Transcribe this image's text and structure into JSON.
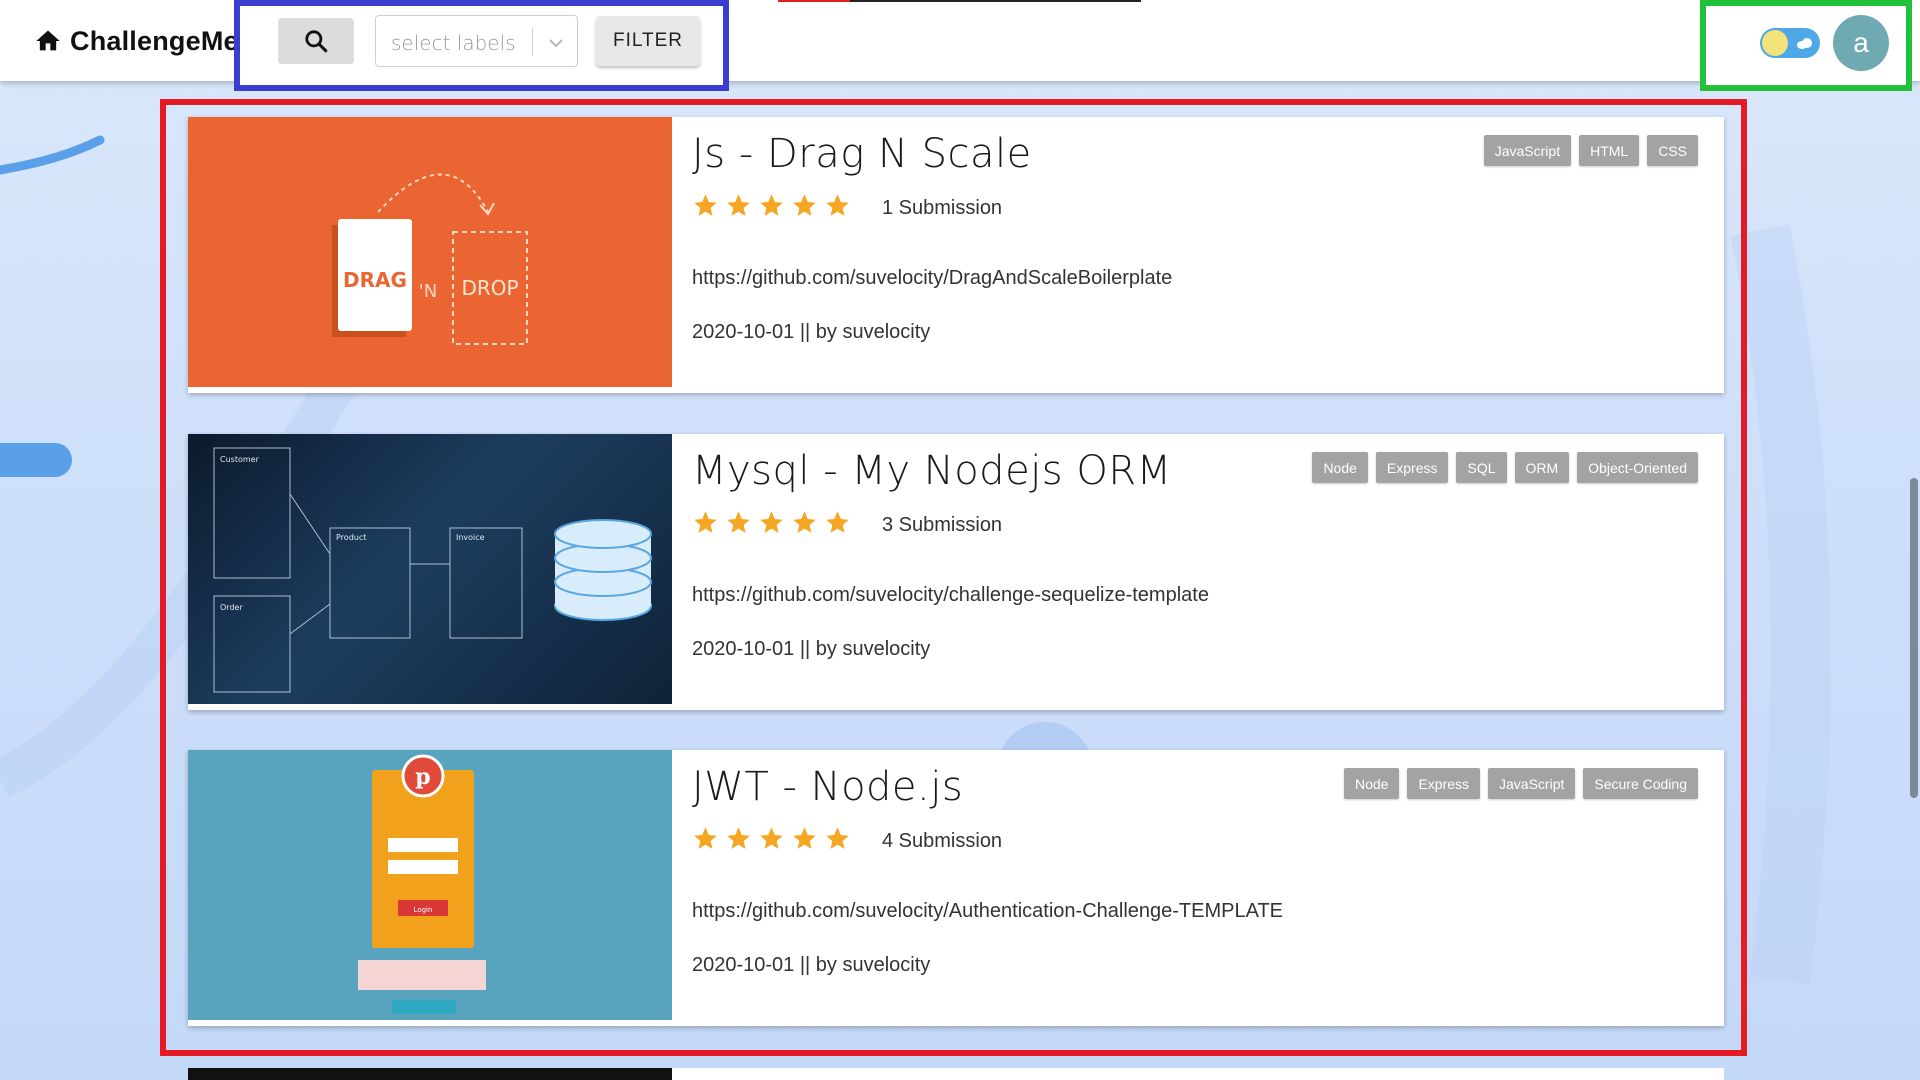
{
  "navbar": {
    "brand": "ChallengeMe",
    "home_icon": "home-icon",
    "search_icon": "search-icon",
    "select_placeholder": "select labels",
    "filter_label": "FILTER",
    "theme_toggle_icon": "sun-cloud-toggle-icon",
    "avatar_letter": "a"
  },
  "colors": {
    "search_highlight": "#3a3ecf",
    "list_highlight": "#e51b23",
    "user_highlight": "#21c13a",
    "star": "#f5a623",
    "tag_bg": "#a3a3a3",
    "avatar_bg": "#6fa9b2"
  },
  "challenges": [
    {
      "title": "Js - Drag N Scale",
      "rating": 5,
      "submissions": "1 Submission",
      "link": "https://github.com/suvelocity/DragAndScaleBoilerplate",
      "meta": "2020-10-01 || by suvelocity",
      "tags": [
        "JavaScript",
        "HTML",
        "CSS"
      ],
      "thumb": {
        "drag": "DRAG",
        "n": "'N",
        "drop": "DROP"
      }
    },
    {
      "title": "Mysql - My Nodejs ORM",
      "rating": 5,
      "submissions": "3 Submission",
      "link": "https://github.com/suvelocity/challenge-sequelize-template",
      "meta": "2020-10-01 || by suvelocity",
      "tags": [
        "Node",
        "Express",
        "SQL",
        "ORM",
        "Object-Oriented"
      ],
      "thumb": {
        "t1": "Customer",
        "t2": "Product",
        "t3": "Invoice",
        "t4": "Order"
      }
    },
    {
      "title": "JWT - Node.js",
      "rating": 5,
      "submissions": "4 Submission",
      "link": "https://github.com/suvelocity/Authentication-Challenge-TEMPLATE",
      "meta": "2020-10-01 || by suvelocity",
      "tags": [
        "Node",
        "Express",
        "JavaScript",
        "Secure Coding"
      ],
      "thumb": {
        "login": "Login"
      }
    }
  ]
}
